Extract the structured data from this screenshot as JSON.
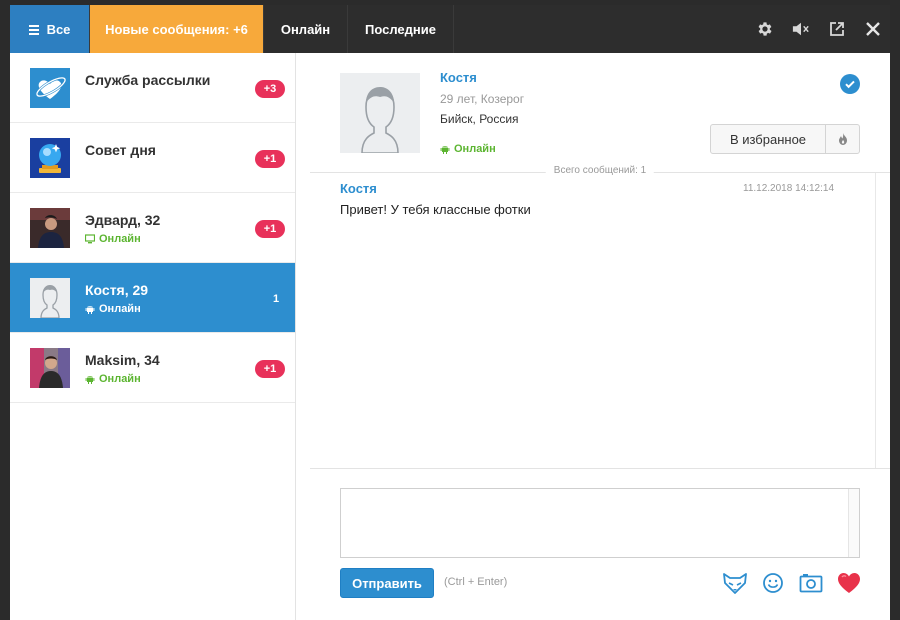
{
  "tabs": {
    "all": "Все",
    "new_messages": "Новые сообщения: +6",
    "online": "Онлайн",
    "recent": "Последние"
  },
  "toolbar_icons": [
    "gear-icon",
    "mute-icon",
    "external-link-icon",
    "close-icon"
  ],
  "contacts": [
    {
      "name": "Служба рассылки",
      "status": "",
      "badge": "+3",
      "avatar": "mailing-service-logo"
    },
    {
      "name": "Совет дня",
      "status": "",
      "badge": "+1",
      "avatar": "tip-of-day-icon"
    },
    {
      "name": "Эдвард, 32",
      "status": "Онлайн",
      "status_icon": "desktop-icon",
      "badge": "+1",
      "avatar": "user-photo"
    },
    {
      "name": "Костя, 29",
      "status": "Онлайн",
      "status_icon": "android-icon",
      "badge": "1",
      "avatar": "default-avatar",
      "active": true
    },
    {
      "name": "Maksim, 34",
      "status": "Онлайн",
      "status_icon": "android-icon",
      "badge": "+1",
      "avatar": "user-photo"
    }
  ],
  "profile": {
    "name": "Костя",
    "age_sign": "29 лет, Козерог",
    "location": "Бийск, Россия",
    "status": "Онлайн",
    "favorite_label": "В избранное"
  },
  "conversation": {
    "total_label": "Всего сообщений: 1",
    "messages": [
      {
        "author": "Костя",
        "time": "11.12.2018 14:12:14",
        "text": "Привет! У тебя классные фотки"
      }
    ]
  },
  "composer": {
    "value": "",
    "placeholder": "",
    "send_label": "Отправить",
    "hint": "(Ctrl + Enter)"
  },
  "composer_tools": [
    "fox-icon",
    "smile-icon",
    "camera-icon",
    "heart-icon"
  ],
  "colors": {
    "accent_blue": "#2d8ecf",
    "orange_tab": "#f7a93b",
    "badge_red": "#e8315a",
    "online_green": "#5cb531"
  }
}
